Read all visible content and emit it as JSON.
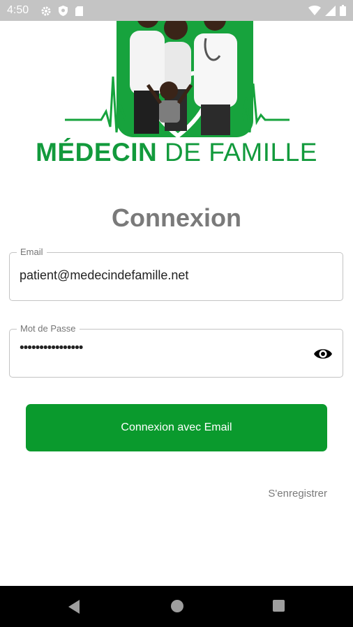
{
  "status_bar": {
    "time": "4:50",
    "left_icons": [
      "gear-icon",
      "shield-icon",
      "sd-card-icon"
    ],
    "right_icons": [
      "wifi-icon",
      "signal-icon",
      "battery-icon"
    ]
  },
  "logo": {
    "brand_bold": "MÉDECIN",
    "brand_rest": " DE FAMILLE",
    "brand_color": "#129a3c"
  },
  "title": "Connexion",
  "email_field": {
    "label": "Email",
    "value": "patient@medecindefamille.net"
  },
  "password_field": {
    "label": "Mot de Passe",
    "masked_value": "••••••••••••••••",
    "toggle_icon": "eye-icon"
  },
  "login_button": {
    "label": "Connexion avec Email",
    "color": "#0a9a2d"
  },
  "register_link": "S'enregistrer",
  "nav_bar": {
    "buttons": [
      "back-icon",
      "home-icon",
      "recents-icon"
    ]
  }
}
